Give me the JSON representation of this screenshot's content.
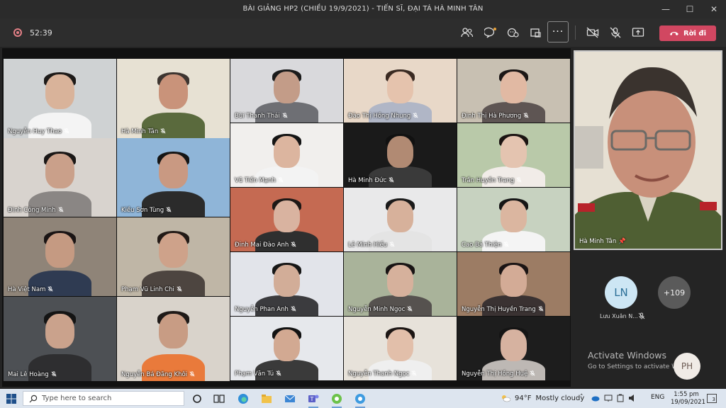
{
  "window": {
    "title": "BÀI GIẢNG HP2 (CHIỀU 19/9/2021) - TIẾN SĨ, ĐẠI TÁ HÀ MINH TÂN",
    "minimize": "—",
    "maximize": "☐",
    "close": "✕"
  },
  "toolbar": {
    "timer": "52:39",
    "more_label": "···",
    "leave_label": "Rời đi"
  },
  "participants": [
    {
      "name": "Nguyễn Huy Thao",
      "bg": "#cfd2d3",
      "skin": "#d9b39a",
      "shirt": "#f4f4f4",
      "hair": "#1d1a18"
    },
    {
      "name": "Hà Minh  Tân",
      "bg": "#e7e1d3",
      "skin": "#c9937a",
      "shirt": "#5a6a3d",
      "hair": "#3d3530"
    },
    {
      "name": "Bùi Thanh Thái",
      "bg": "#d9d9dc",
      "skin": "#c39c88",
      "shirt": "#6e6f74",
      "hair": "#1a1a1a"
    },
    {
      "name": "Đào Thị Hồng Nhung",
      "bg": "#e8d8c8",
      "skin": "#e5c3ad",
      "shirt": "#b0b6c6",
      "hair": "#3a2a22"
    },
    {
      "name": "Đinh Thị Hà Phương",
      "bg": "#c8c0b2",
      "skin": "#e1b9a3",
      "shirt": "#5e5553",
      "hair": "#1c1716"
    },
    {
      "name": "Đinh Công Minh",
      "bg": "#d8d3ce",
      "skin": "#caa08a",
      "shirt": "#8a8684",
      "hair": "#1a1716"
    },
    {
      "name": "Kiều Sơn Tùng",
      "bg": "#8fb5d8",
      "skin": "#c99982",
      "shirt": "#2b2b2b",
      "hair": "#151515"
    },
    {
      "name": "Vũ Tiến Mạnh",
      "bg": "#f1efed",
      "skin": "#dcb59f",
      "shirt": "#f3f3f3",
      "hair": "#141414"
    },
    {
      "name": "Hà Minh Đức",
      "bg": "#1a1a1a",
      "skin": "#b18a73",
      "shirt": "#3a3a3a",
      "hair": "#111111"
    },
    {
      "name": "Trần Huyền Trang",
      "bg": "#b9c9a9",
      "skin": "#e4c4b0",
      "shirt": "#f1ece8",
      "hair": "#1b1412"
    },
    {
      "name": "Hà Việt Nam",
      "bg": "#8f8478",
      "skin": "#c59a82",
      "shirt": "#2f3b52",
      "hair": "#1a1414"
    },
    {
      "name": "Phạm Vũ Linh Chi",
      "bg": "#bfb6a6",
      "skin": "#cea28a",
      "shirt": "#4d4540",
      "hair": "#221a16"
    },
    {
      "name": "Đinh Mai Đào Anh",
      "bg": "#c56a52",
      "skin": "#d9b3a0",
      "shirt": "#2f2f2f",
      "hair": "#1d1816"
    },
    {
      "name": "Lê Minh Hiếu",
      "bg": "#e9e9ea",
      "skin": "#d7b19b",
      "shirt": "#e4e4e4",
      "hair": "#1a1a1a"
    },
    {
      "name": "Cao Bá Thiện",
      "bg": "#c7d2c0",
      "skin": "#dbb6a0",
      "shirt": "#f4f4f4",
      "hair": "#161616"
    },
    {
      "name": "Mai Lê Hoàng",
      "bg": "#4d5054",
      "skin": "#caa28c",
      "shirt": "#2e2e30",
      "hair": "#141414"
    },
    {
      "name": "Nguyễn Bá Đăng Khôi",
      "bg": "#d9d3cb",
      "skin": "#c89c84",
      "shirt": "#e97a3b",
      "hair": "#1f1a18"
    },
    {
      "name": "Nguyễn Phan Anh",
      "bg": "#e2e4ea",
      "skin": "#d2ad98",
      "shirt": "#3b3b3e",
      "hair": "#161616"
    },
    {
      "name": "Nguyễn Minh Ngọc",
      "bg": "#a9b39a",
      "skin": "#d6b19c",
      "shirt": "#56524f",
      "hair": "#181414"
    },
    {
      "name": "Nguyễn Thị Huyền Trang",
      "bg": "#9c7c64",
      "skin": "#d3ab96",
      "shirt": "#3a3232",
      "hair": "#1a1414"
    },
    {
      "name": "Phạm Văn Tú",
      "bg": "#e6e8ec",
      "skin": "#d2a992",
      "shirt": "#3a3a3a",
      "hair": "#121212"
    },
    {
      "name": "Nguyễn Thanh Ngọc",
      "bg": "#e7e2da",
      "skin": "#e2bfaa",
      "shirt": "#efefef",
      "hair": "#1c1614"
    },
    {
      "name": "Nguyễn Thị Hồng Huệ",
      "bg": "#1d1d1d",
      "skin": "#d6b2a0",
      "shirt": "#bdb8b4",
      "hair": "#151515"
    }
  ],
  "spotlight": {
    "name": "Hà Minh Tân"
  },
  "side_participant": {
    "initials": "LN",
    "name": "Lưu Xuân N..."
  },
  "overflow": {
    "count": "+109"
  },
  "watermark": {
    "line1": "Activate Windows",
    "line2": "Go to Settings to activate Wi"
  },
  "self_avatar": {
    "initials": "PH"
  },
  "taskbar": {
    "search_placeholder": "Type here to search",
    "temperature": "94°F",
    "weather": "Mostly cloudy",
    "lang": "ENG",
    "time": "1:55 pm",
    "date": "19/09/2021",
    "notifications": "3"
  },
  "colors": {
    "leave_button": "#d14761",
    "recording": "#e27f86",
    "taskbar": "#dde5ef"
  }
}
